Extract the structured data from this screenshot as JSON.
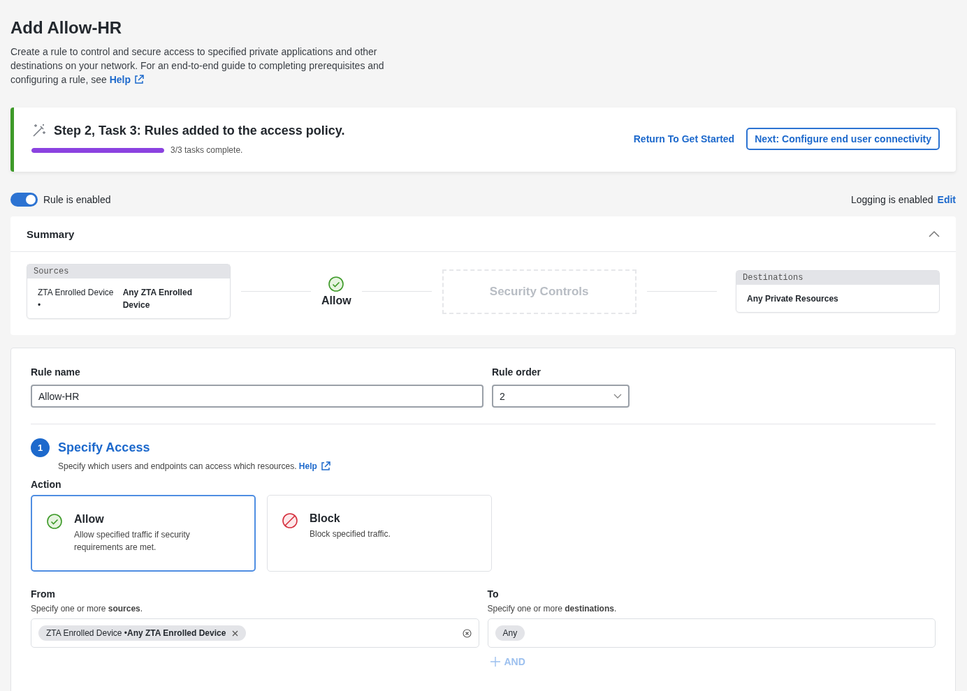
{
  "page": {
    "title": "Add Allow-HR",
    "description": "Create a rule to control and secure access to specified private applications and other destinations on your network. For an end-to-end guide to completing prerequisites and configuring a rule, see",
    "help_link": "Help"
  },
  "task_banner": {
    "title": "Step 2, Task 3: Rules added to the access policy.",
    "level": 1,
    "progress_text": "3/3 tasks complete.",
    "link": "Return To Get Started",
    "button": "Next: Configure end user connectivity"
  },
  "rule_toggle": {
    "on": true,
    "label": "Rule is enabled"
  },
  "logging": {
    "text": "Logging is enabled",
    "link": "Edit"
  },
  "summary": {
    "title": "Summary",
    "expanded": true,
    "sources": {
      "heading": "Sources",
      "type": "ZTA Enrolled Device •",
      "value": "Any ZTA Enrolled Device"
    },
    "action": "Allow",
    "security_controls": "Security Controls",
    "destinations": {
      "heading": "Destinations",
      "value": "Any Private Resources"
    }
  },
  "form": {
    "rule_name": {
      "label": "Rule name",
      "value": "Allow-HR"
    },
    "rule_order": {
      "label": "Rule order",
      "value": "2"
    },
    "section": {
      "number": "1",
      "title": "Specify Access",
      "description": "Specify which users and endpoints can access which resources.",
      "help_link": "Help"
    },
    "action_label": "Action",
    "actions": [
      {
        "kind": "allow",
        "title": "Allow",
        "description": "Allow specified traffic if security requirements are met.",
        "selected": true
      },
      {
        "kind": "block",
        "title": "Block",
        "description": "Block specified traffic.",
        "selected": false
      }
    ],
    "from": {
      "label": "From",
      "hint": "Specify one or more **sources**.",
      "chips": [
        "ZTA Enrolled Device •**Any ZTA Enrolled Device**"
      ]
    },
    "to": {
      "label": "To",
      "hint": "Specify one or more **destinations**.",
      "chips": [
        "Any"
      ],
      "add_button": "AND"
    }
  }
}
